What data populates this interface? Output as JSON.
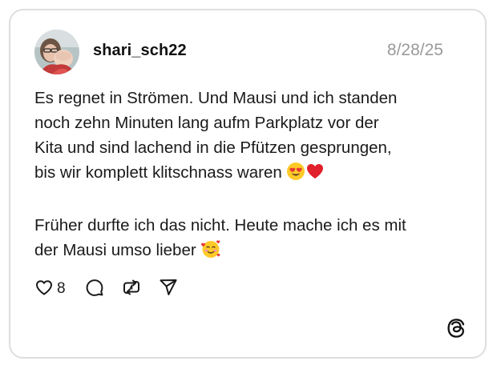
{
  "post": {
    "username": "shari_sch22",
    "date": "8/28/25",
    "paragraph_1": "Es regnet in Strömen. Und Mausi und ich standen\nnoch zehn Minuten lang aufm Parkplatz vor der\nKita und sind lachend in die Pfützen gesprungen,\nbis wir komplett klitschnass waren",
    "paragraph_1_emojis": [
      "heart-eyes-emoji",
      "red-heart-emoji"
    ],
    "paragraph_2": "Früher durfte ich das nicht. Heute mache ich es mit\nder Mausi umso lieber",
    "paragraph_2_emojis": [
      "smiling-face-with-hearts-emoji"
    ],
    "like_count": "8"
  },
  "actions": {
    "icons": [
      "heart-icon",
      "comment-icon",
      "repost-icon",
      "share-icon"
    ]
  },
  "branding": {
    "logo": "threads-logo-icon"
  }
}
